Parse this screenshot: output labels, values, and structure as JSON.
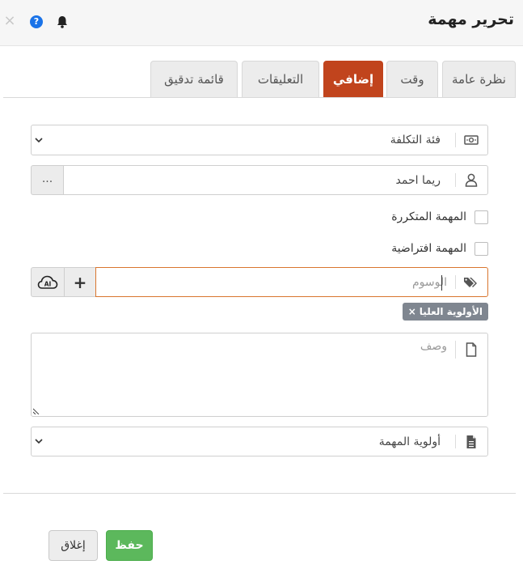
{
  "header": {
    "title": "تحرير مهمة",
    "close_glyph": "×",
    "help_glyph": "?",
    "icons": [
      "close-icon",
      "help-icon",
      "bell-icon"
    ]
  },
  "tabs": [
    {
      "label": "نظرة عامة",
      "active": false
    },
    {
      "label": "وقت",
      "active": false
    },
    {
      "label": "إضافي",
      "active": true
    },
    {
      "label": "التعليقات",
      "active": false
    },
    {
      "label": "قائمة تدقيق",
      "active": false
    }
  ],
  "form": {
    "cost_category": {
      "value": "فئة التكلفة",
      "icon": "money-icon"
    },
    "assignee": {
      "value": "ريما احمد",
      "more_label": "...",
      "icon": "user-icon"
    },
    "recurring_task": {
      "label": "المهمة المتكررة",
      "checked": false
    },
    "virtual_task": {
      "label": "المهمة افتراضية",
      "checked": false
    },
    "tags": {
      "placeholder": "الوسوم",
      "add_label": "+",
      "ai_label": "AI",
      "icon": "tags-icon",
      "chips": [
        {
          "label": "الأولوية العليا",
          "remove": "×"
        }
      ]
    },
    "description": {
      "placeholder": "وصف",
      "icon": "file-icon"
    },
    "priority": {
      "value": "أولوية المهمة",
      "icon": "document-icon"
    }
  },
  "footer": {
    "save_label": "حفظ",
    "close_label": "إغلاق"
  },
  "colors": {
    "active_tab": "#c1441d",
    "save_button": "#5cb85c",
    "help_icon": "#1a73e8",
    "chip": "#7f8690",
    "focus_border": "#d9762f"
  }
}
